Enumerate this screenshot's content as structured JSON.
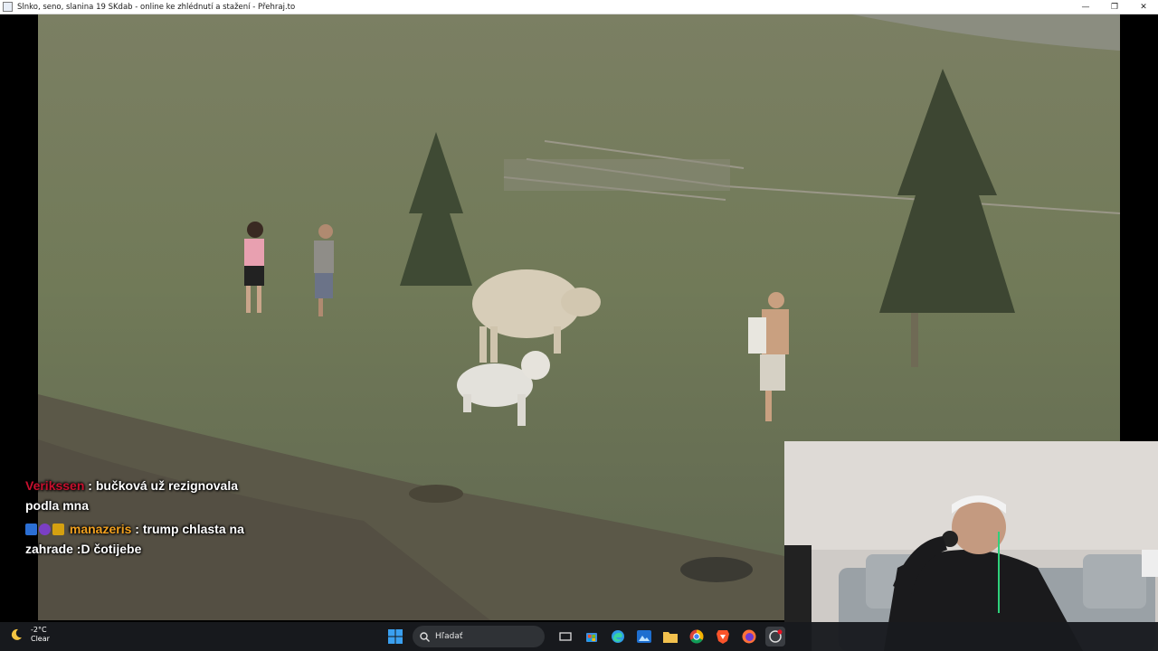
{
  "window": {
    "title": "Slnko, seno, slanina 19 SKdab - online ke zhlédnutí a stažení - Přehraj.to",
    "minimize_glyph": "—",
    "maximize_glyph": "❐",
    "close_glyph": "✕"
  },
  "chat": {
    "messages": [
      {
        "user": "Verikssen",
        "separator": " : ",
        "text": "bučková už rezignovala podla mna",
        "user_color": "#c8102e"
      },
      {
        "user": "manazeris",
        "separator": " : ",
        "text": "trump chlasta na zahrade :D čotijebe",
        "user_color": "#f0a020"
      }
    ]
  },
  "taskbar": {
    "weather": {
      "temperature": "-2°C",
      "condition": "Clear"
    },
    "search_placeholder": "Hľadať",
    "icons": [
      "windows-start-icon",
      "search-icon",
      "task-view-icon",
      "store-icon",
      "edge-icon",
      "photos-icon",
      "file-explorer-icon",
      "chrome-icon",
      "brave-icon",
      "firefox-icon",
      "app-icon"
    ]
  },
  "colors": {
    "grass": "#6f7a58",
    "taskbar": "#181a1e",
    "accent": "#0078d4"
  }
}
